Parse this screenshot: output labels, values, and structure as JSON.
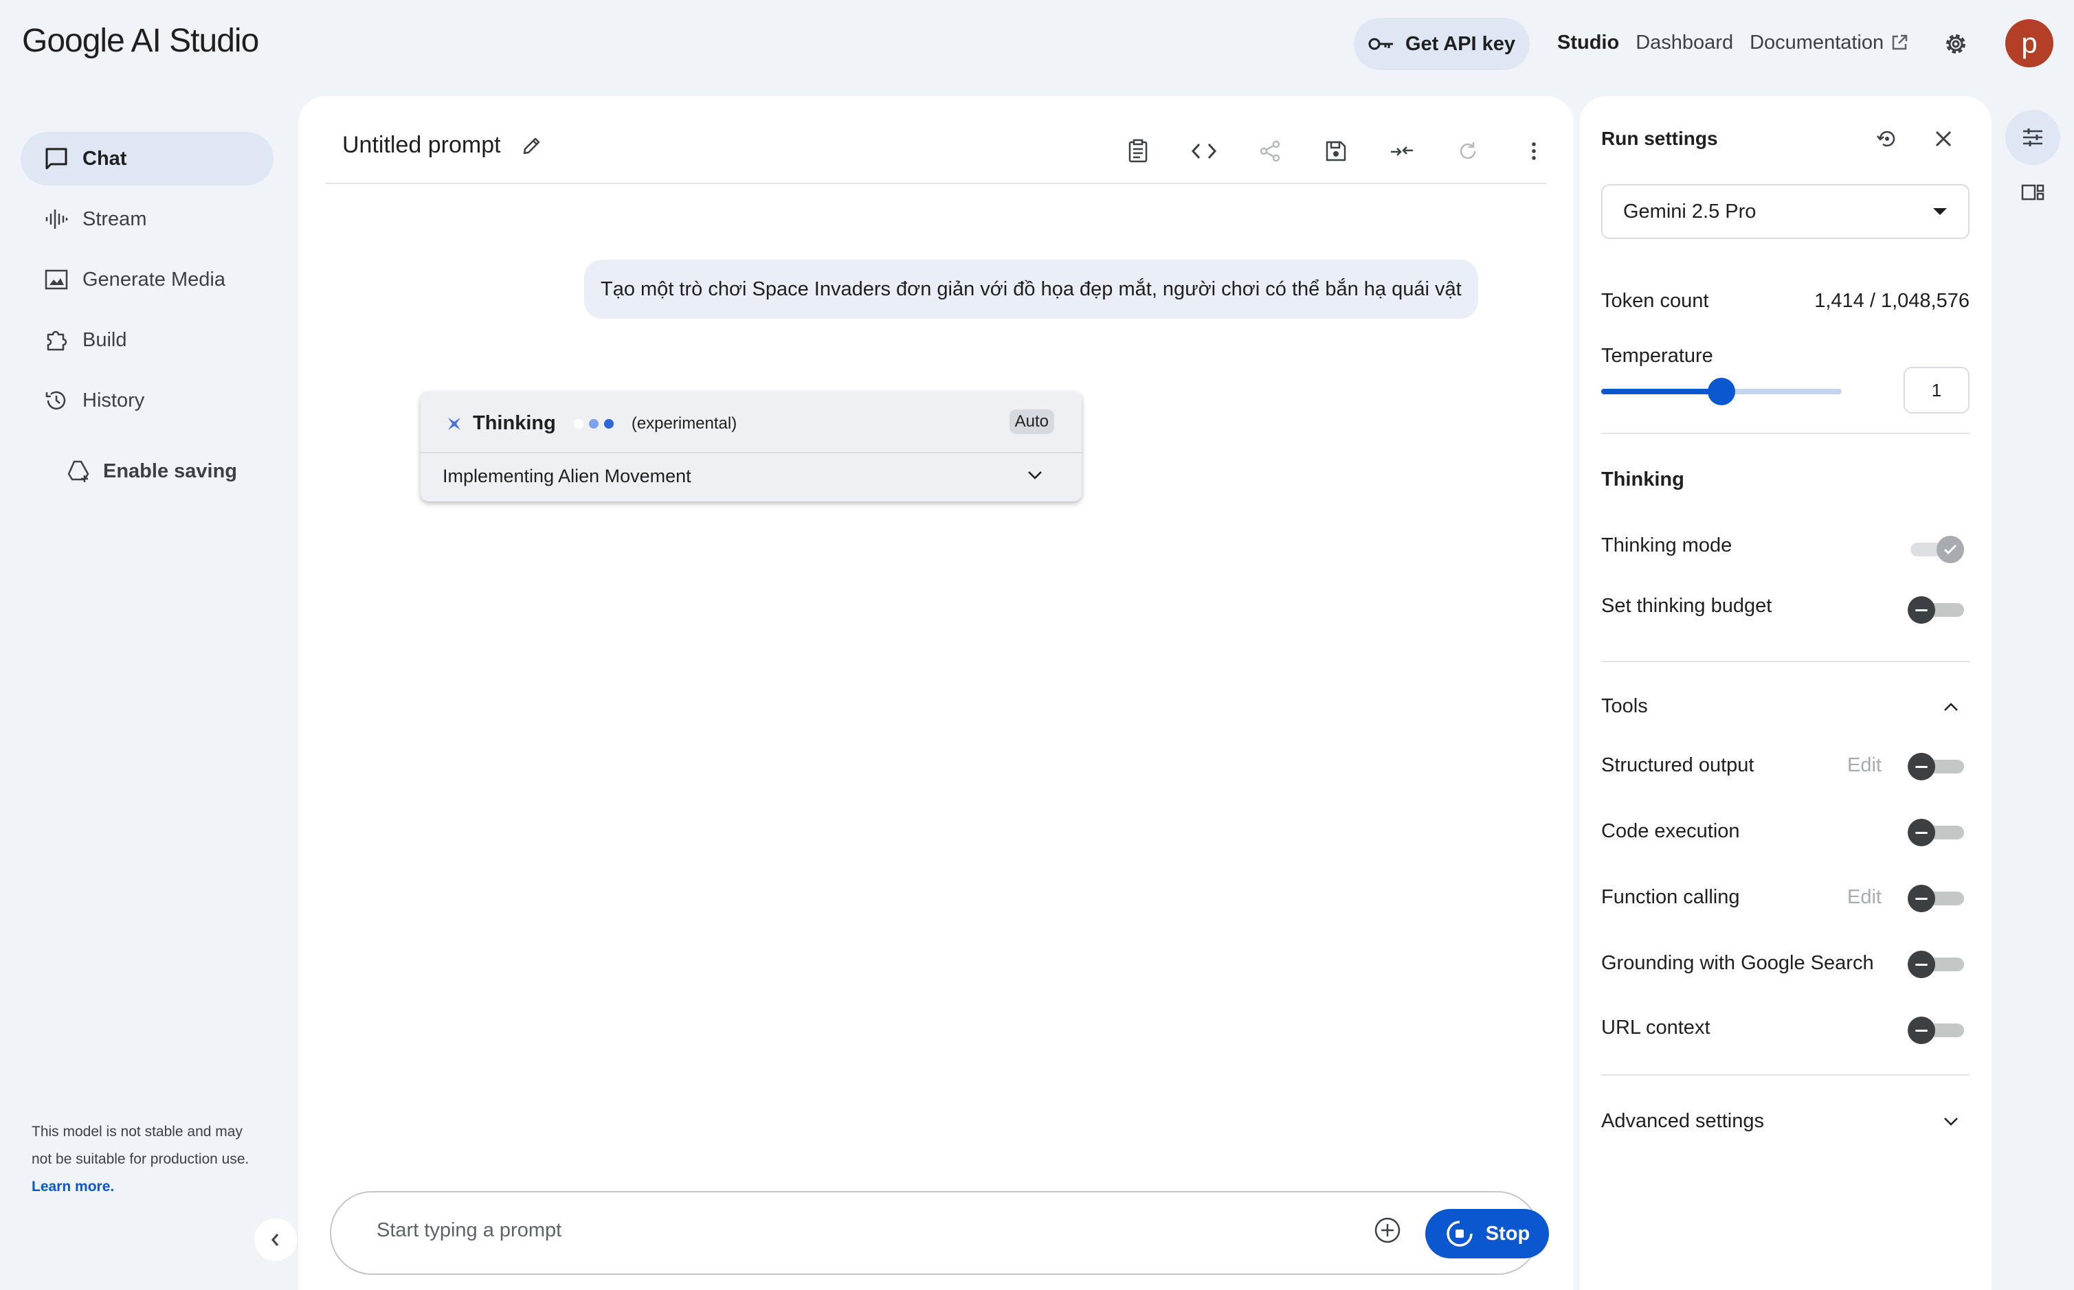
{
  "app": {
    "logo": "Google AI Studio"
  },
  "header": {
    "api_key_label": "Get API key",
    "nav": {
      "studio": "Studio",
      "dashboard": "Dashboard",
      "documentation": "Documentation"
    },
    "avatar_initial": "p"
  },
  "sidebar": {
    "items": [
      {
        "label": "Chat",
        "icon": "chat-icon"
      },
      {
        "label": "Stream",
        "icon": "stream-icon"
      },
      {
        "label": "Generate Media",
        "icon": "image-icon"
      },
      {
        "label": "Build",
        "icon": "build-icon"
      },
      {
        "label": "History",
        "icon": "history-icon"
      }
    ],
    "enable_saving": "Enable saving",
    "model_note": "This model is not stable and may not be suitable for production use.",
    "learn_more": "Learn more."
  },
  "main": {
    "prompt_title": "Untitled prompt",
    "user_message": "Tạo một trò chơi Space Invaders đơn giản với đồ họa đẹp mắt, người chơi có thể bắn hạ quái vật",
    "thinking": {
      "title": "Thinking",
      "experimental": "(experimental)",
      "badge": "Auto",
      "summary": "Implementing Alien Movement"
    },
    "prompt_bar": {
      "placeholder": "Start typing a prompt",
      "stop_label": "Stop"
    }
  },
  "run_settings": {
    "title": "Run settings",
    "model": "Gemini 2.5 Pro",
    "token_count_label": "Token count",
    "token_count_value": "1,414 / 1,048,576",
    "temperature_label": "Temperature",
    "temperature_value": "1",
    "temperature_fraction": 0.5,
    "thinking_section": "Thinking",
    "thinking_mode_label": "Thinking mode",
    "thinking_budget_label": "Set thinking budget",
    "tools_title": "Tools",
    "edit_label": "Edit",
    "tools": {
      "structured_output": "Structured output",
      "code_execution": "Code execution",
      "function_calling": "Function calling",
      "grounding": "Grounding with Google Search",
      "url_context": "URL context"
    },
    "advanced_settings": "Advanced settings"
  },
  "colors": {
    "accent": "#0b57d0",
    "page_bg": "#f0f3f8",
    "active_pill": "#dfe7f4",
    "avatar": "#b33f26"
  }
}
